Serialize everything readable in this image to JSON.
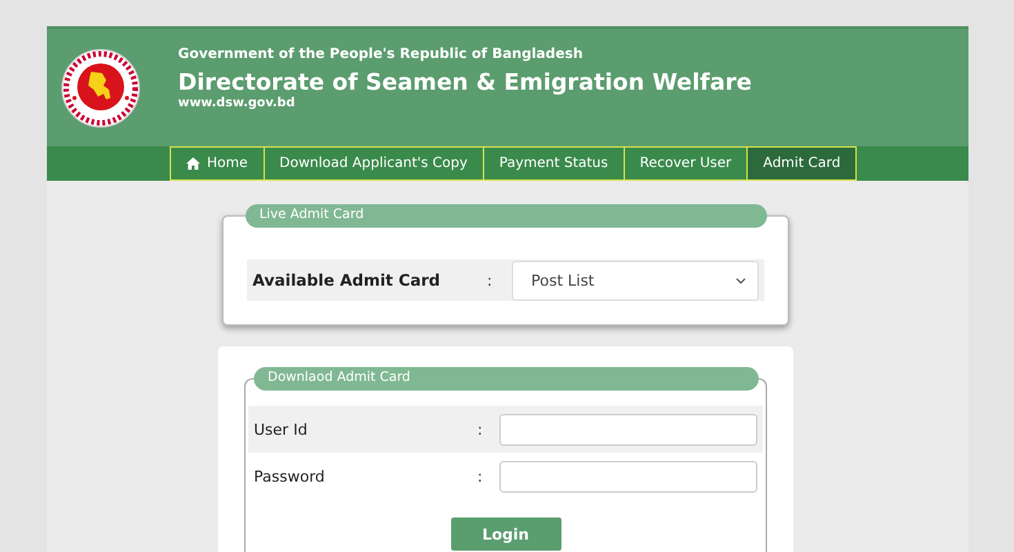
{
  "header": {
    "government": "Government of the People's Republic of Bangladesh",
    "title": "Directorate of Seamen & Emigration Welfare",
    "website": "www.dsw.gov.bd"
  },
  "nav": [
    {
      "label": "Home",
      "kind": "home",
      "selected": false
    },
    {
      "label": "Download Applicant's Copy",
      "kind": "link",
      "selected": false
    },
    {
      "label": "Payment Status",
      "kind": "link",
      "selected": false
    },
    {
      "label": "Recover User",
      "kind": "link",
      "selected": false
    },
    {
      "label": "Admit Card",
      "kind": "link",
      "selected": true
    }
  ],
  "live_admit_card": {
    "legend": "Live Admit Card",
    "label": "Available Admit Card",
    "colon": ":",
    "select": {
      "value": "Post List"
    }
  },
  "download_admit_card": {
    "legend": "Downlaod Admit Card",
    "fields": [
      {
        "label": "User Id",
        "colon": ":"
      },
      {
        "label": "Password",
        "colon": ":"
      }
    ],
    "button": "Login"
  }
}
